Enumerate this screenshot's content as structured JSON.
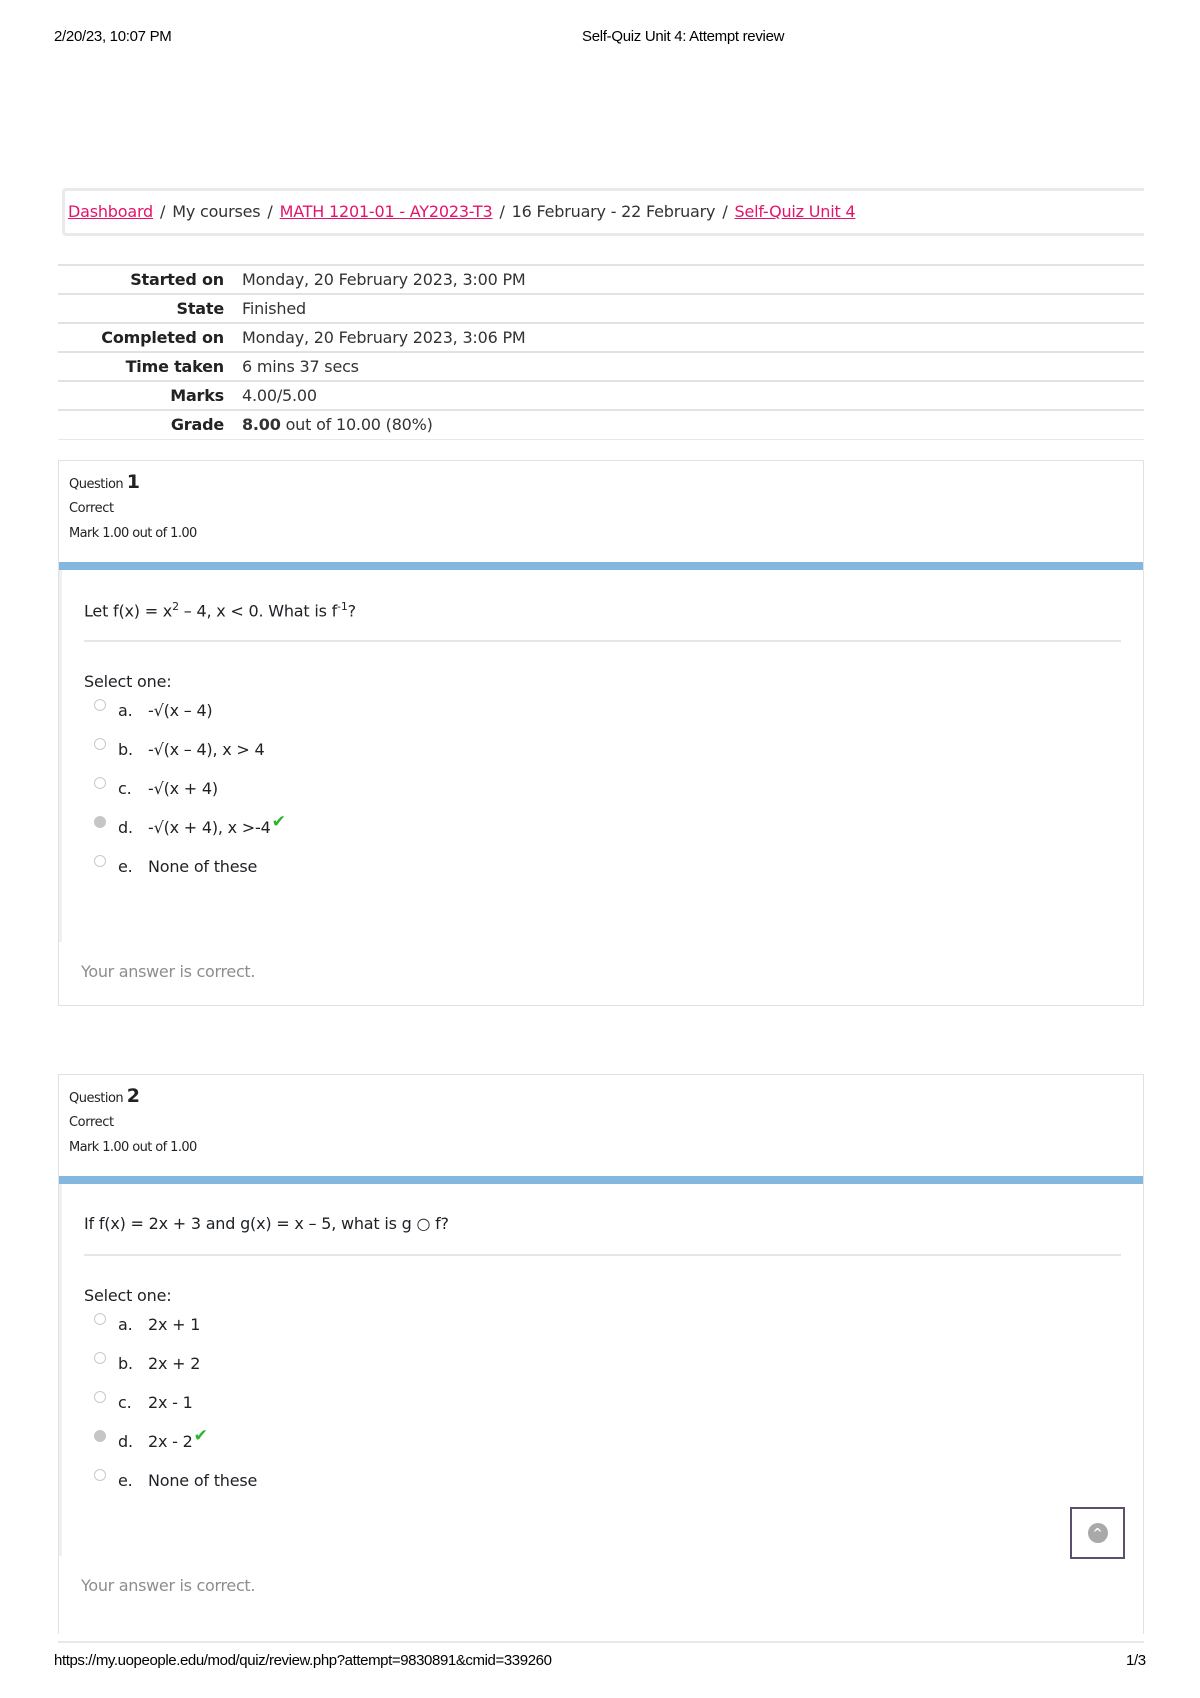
{
  "print_header": {
    "datetime": "2/20/23, 10:07 PM",
    "title": "Self-Quiz Unit 4: Attempt review"
  },
  "breadcrumb": {
    "items": [
      {
        "label": "Dashboard",
        "link": true
      },
      {
        "label": "My courses",
        "link": false
      },
      {
        "label": "MATH 1201-01 - AY2023-T3",
        "link": true
      },
      {
        "label": "16 February - 22 February",
        "link": false
      },
      {
        "label": "Self-Quiz Unit 4",
        "link": true
      }
    ],
    "separator": "/"
  },
  "summary": {
    "rows": [
      {
        "label": "Started on",
        "value": "Monday, 20 February 2023, 3:00 PM"
      },
      {
        "label": "State",
        "value": "Finished"
      },
      {
        "label": "Completed on",
        "value": "Monday, 20 February 2023, 3:06 PM"
      },
      {
        "label": "Time taken",
        "value": "6 mins 37 secs"
      },
      {
        "label": "Marks",
        "value": "4.00/5.00"
      },
      {
        "label": "Grade",
        "value_bold": "8.00",
        "value": " out of 10.00 (80%)"
      }
    ]
  },
  "questions": [
    {
      "label": "Question",
      "number": "1",
      "state": "Correct",
      "mark": "Mark 1.00 out of 1.00",
      "text_pre": "Let f(x) =  x",
      "text_sup": "2",
      "text_mid": " – 4, x < 0. What is f",
      "text_sup2": "-1",
      "text_post": "?",
      "prompt": "Select one:",
      "options": [
        {
          "letter": "a.",
          "text": "-√(x – 4)",
          "selected": false,
          "correct": false
        },
        {
          "letter": "b.",
          "text": "-√(x – 4), x > 4",
          "selected": false,
          "correct": false
        },
        {
          "letter": "c.",
          "text": "-√(x + 4)",
          "selected": false,
          "correct": false
        },
        {
          "letter": "d.",
          "text": "-√(x + 4), x >-4",
          "selected": true,
          "correct": true
        },
        {
          "letter": "e.",
          "text": "None of these",
          "selected": false,
          "correct": false
        }
      ],
      "feedback": "Your answer is correct."
    },
    {
      "label": "Question",
      "number": "2",
      "state": "Correct",
      "mark": "Mark 1.00 out of 1.00",
      "text": "If f(x) = 2x + 3 and g(x) = x – 5, what is g ○ f?",
      "prompt": "Select one:",
      "options": [
        {
          "letter": "a.",
          "text": "2x + 1",
          "selected": false,
          "correct": false
        },
        {
          "letter": "b.",
          "text": "2x + 2",
          "selected": false,
          "correct": false
        },
        {
          "letter": "c.",
          "text": "2x - 1",
          "selected": false,
          "correct": false
        },
        {
          "letter": "d.",
          "text": "2x - 2",
          "selected": true,
          "correct": true
        },
        {
          "letter": "e.",
          "text": "None of these",
          "selected": false,
          "correct": false
        }
      ],
      "feedback": "Your answer is correct."
    }
  ],
  "check_icon": "✔",
  "back_to_top_icon": "^",
  "print_footer": {
    "url": "https://my.uopeople.edu/mod/quiz/review.php?attempt=9830891&cmid=339260",
    "page": "1/3"
  },
  "colors": {
    "link": "#e4136b",
    "bar": "#83b7dd",
    "check": "#2bb52b"
  }
}
